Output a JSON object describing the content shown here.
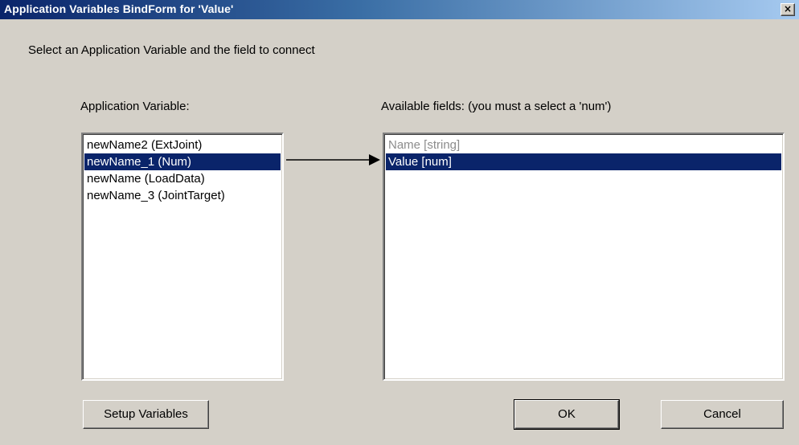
{
  "window": {
    "title": "Application Variables BindForm for 'Value'",
    "close_label": "×"
  },
  "instruction": "Select an  Application Variable and the field to connect",
  "app_variables": {
    "label": "Application Variable:",
    "items": [
      {
        "label": "newName2 (ExtJoint)",
        "selected": false
      },
      {
        "label": "newName_1 (Num)",
        "selected": true
      },
      {
        "label": "newName (LoadData)",
        "selected": false
      },
      {
        "label": "newName_3 (JointTarget)",
        "selected": false
      }
    ]
  },
  "fields": {
    "label": "Available fields: (you must a select a 'num')",
    "items": [
      {
        "label": "Name [string]",
        "enabled": false
      },
      {
        "label": "Value [num]",
        "enabled": true,
        "selected": true
      }
    ]
  },
  "buttons": {
    "setup_variables": "Setup Variables",
    "ok": "OK",
    "cancel": "Cancel"
  },
  "colors": {
    "selection": "#0a246a",
    "face": "#d4d0c8"
  }
}
